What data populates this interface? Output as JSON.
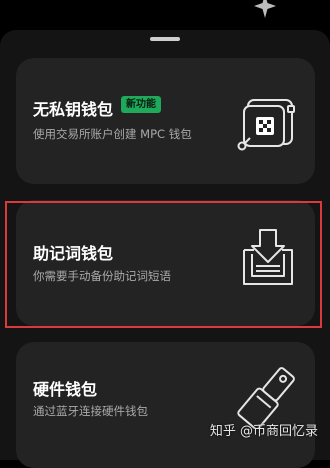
{
  "wallets": [
    {
      "title": "无私钥钱包",
      "badge": "新功能",
      "description": "使用交易所账户创建 MPC 钱包",
      "icon": "mpc-wallet-icon"
    },
    {
      "title": "助记词钱包",
      "description": "你需要手动备份助记词短语",
      "icon": "mnemonic-download-icon"
    },
    {
      "title": "硬件钱包",
      "description": "通过蓝牙连接硬件钱包",
      "icon": "hardware-usb-key-icon"
    }
  ],
  "watermark": "知乎 @币商回忆录",
  "colors": {
    "background": "#000000",
    "sheet": "#141414",
    "card": "#232323",
    "badge": "#1fa95b",
    "highlight": "#d93a3a"
  }
}
